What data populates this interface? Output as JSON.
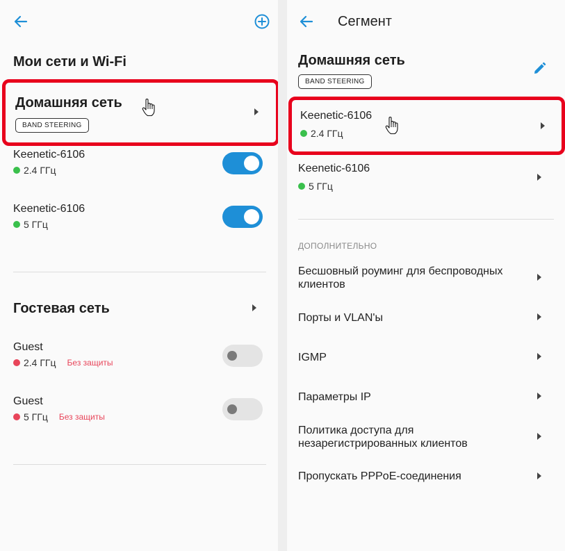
{
  "colors": {
    "accent": "#1e8fd7",
    "highlight": "#e8001c",
    "status_green": "#3ac04c",
    "status_red": "#e8455a"
  },
  "left_screen": {
    "back_icon": "arrow-left-icon",
    "add_icon": "plus-circle-icon",
    "title": "Мои сети и Wi-Fi",
    "home_network": {
      "title": "Домашняя сеть",
      "badge": "BAND STEERING",
      "networks": [
        {
          "name": "Keenetic-6106",
          "band": "2.4 ГГц",
          "status": "green",
          "enabled": true
        },
        {
          "name": "Keenetic-6106",
          "band": "5 ГГц",
          "status": "green",
          "enabled": true
        }
      ]
    },
    "guest_network": {
      "title": "Гостевая сеть",
      "networks": [
        {
          "name": "Guest",
          "band": "2.4 ГГц",
          "status": "red",
          "security": "Без защиты",
          "enabled": false
        },
        {
          "name": "Guest",
          "band": "5 ГГц",
          "status": "red",
          "security": "Без защиты",
          "enabled": false
        }
      ]
    }
  },
  "right_screen": {
    "back_icon": "arrow-left-icon",
    "appbar_title": "Сегмент",
    "title": "Домашняя сеть",
    "badge": "BAND STEERING",
    "edit_icon": "pencil-icon",
    "networks": [
      {
        "name": "Keenetic-6106",
        "band": "2.4 ГГц",
        "status": "green"
      },
      {
        "name": "Keenetic-6106",
        "band": "5 ГГц",
        "status": "green"
      }
    ],
    "section_label": "ДОПОЛНИТЕЛЬНО",
    "menu_items": [
      "Бесшовный роуминг для беспроводных клиентов",
      "Порты и VLAN'ы",
      "IGMP",
      "Параметры IP",
      "Политика доступа для незарегистрированных клиентов",
      "Пропускать PPPoE-соединения"
    ]
  }
}
